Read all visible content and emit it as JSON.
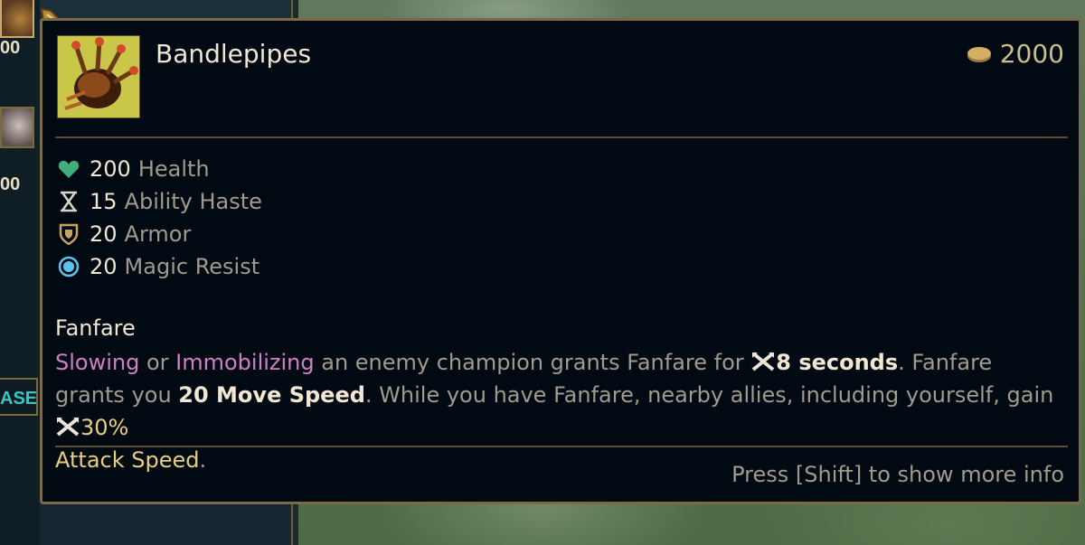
{
  "shop": {
    "slot_prices": [
      "00",
      "00"
    ],
    "purchase_tab_label": "ASE"
  },
  "tooltip": {
    "item_name": "Bandlepipes",
    "item_icon": "bandlepipes-icon",
    "cost": "2000",
    "stats": [
      {
        "icon": "heart-icon",
        "value": "200",
        "label": "Health",
        "color": "#3fae7e"
      },
      {
        "icon": "hourglass-icon",
        "value": "15",
        "label": "Ability Haste",
        "color": "#d8d4c6"
      },
      {
        "icon": "shield-icon",
        "value": "20",
        "label": "Armor",
        "color": "#c9a060"
      },
      {
        "icon": "magic-resist-icon",
        "value": "20",
        "label": "Magic Resist",
        "color": "#5cc4f0"
      }
    ],
    "passive": {
      "name": "Fanfare",
      "kw_slowing": "Slowing",
      "t_or": " or ",
      "kw_immobilizing": "Immobilizing",
      "t_1": " an enemy champion grants Fanfare for ",
      "duration": "8 seconds",
      "t_2": ". Fanfare grants you ",
      "move_speed": "20 Move Speed",
      "t_3": ". While you have Fanfare, nearby allies, including yourself, gain ",
      "attack_speed_value": "30%",
      "attack_speed_label": "Attack Speed",
      "t_end": "."
    },
    "footer_hint": "Press [Shift] to show more info"
  },
  "colors": {
    "keyword_pink": "#d080c0",
    "keyword_gold": "#e9cf7c",
    "text_muted": "#a09b8c",
    "text_bright": "#f0e6d2",
    "gold_cost": "#cdbe91",
    "border_gold": "#7a6a47"
  }
}
